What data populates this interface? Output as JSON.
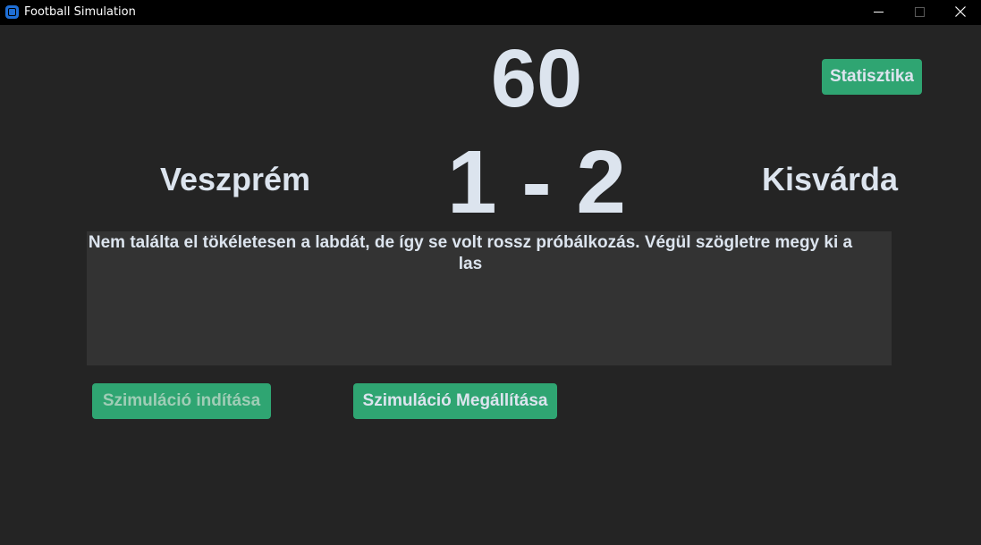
{
  "window": {
    "title": "Football Simulation",
    "icon": "app-logo-icon"
  },
  "match": {
    "minute": "60",
    "home_team": "Veszprém",
    "away_team": "Kisvárda",
    "score": "1 - 2"
  },
  "commentary": {
    "text": "Nem találta el tökéletesen a labdát, de így se volt rossz próbálkozás. Végül szögletre megy ki a las"
  },
  "buttons": {
    "stats": "Statisztika",
    "start": "Szimuláció indítása",
    "stop": "Szimuláció Megállítása"
  },
  "colors": {
    "background": "#242424",
    "titlebar": "#000000",
    "accent": "#2fa572",
    "text": "#dce4ee",
    "textbox": "#333333",
    "disabled_text": "#9fcdb6"
  }
}
